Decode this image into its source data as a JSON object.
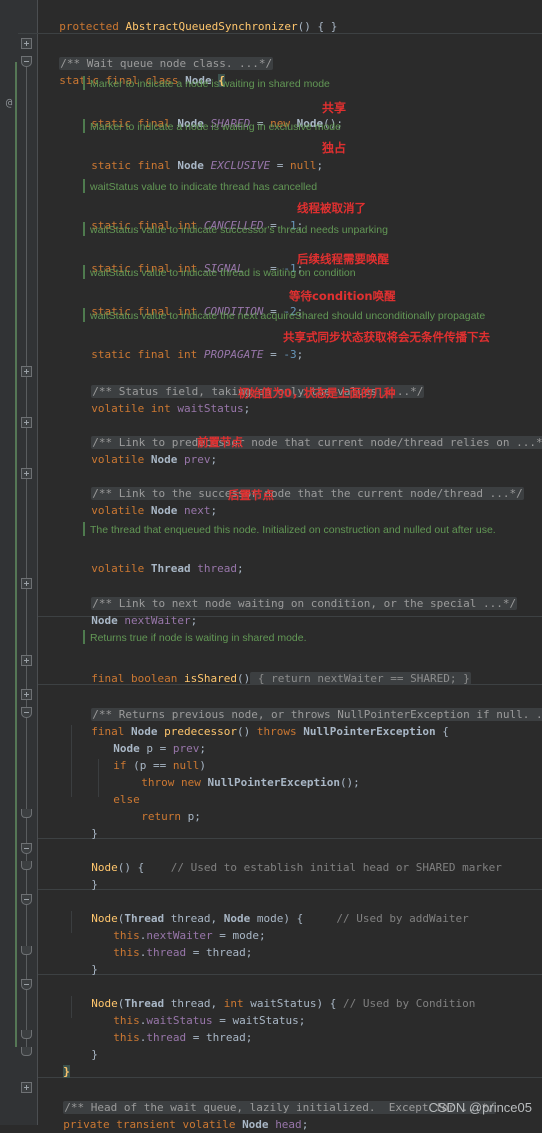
{
  "app": {
    "title": "AbstractQueuedSynchronizer.java",
    "theme": "darcula",
    "accent": "#cc7832",
    "annotation_color": "#e03030",
    "brace_highlight_color": "#3b514d"
  },
  "gutter": {
    "at_icon": "@",
    "fold_collapsed_icon": "+",
    "fold_expanded_icon": "-"
  },
  "code": {
    "l1": {
      "kw": "protected ",
      "name": "AbstractQueuedSynchronizer",
      "rest": "() { }"
    },
    "l2": {
      "folded_doc": "/** Wait queue node class. ...*/"
    },
    "l3": {
      "kw": "static final class ",
      "type": "Node",
      "brace": "{"
    },
    "l4": {
      "doc": "Marker to indicate a node is waiting in shared mode"
    },
    "l5": {
      "kw": "static final ",
      "type": "Node ",
      "sfield": "SHARED",
      "eq": " = ",
      "new": "new ",
      "call": "Node",
      "rest": "();"
    },
    "l5a": {
      "anno": "共享"
    },
    "l6": {
      "doc": "Marker to indicate a node is waiting in exclusive mode"
    },
    "l7": {
      "kw": "static final ",
      "type": "Node ",
      "sfield": "EXCLUSIVE",
      "eq": " = ",
      "kw2": "null",
      "rest": ";"
    },
    "l7a": {
      "anno": "独占"
    },
    "l8": {
      "doc": "waitStatus value to indicate thread has cancelled"
    },
    "l9": {
      "kw": "static final int ",
      "sfield": "CANCELLED",
      "eq": " =  ",
      "num": "1",
      "rest": ";"
    },
    "l9a": {
      "anno": "线程被取消了"
    },
    "l10": {
      "doc": "waitStatus value to indicate successor's thread needs unparking"
    },
    "l11": {
      "kw": "static final int ",
      "sfield": "SIGNAL",
      "eq": "    = ",
      "num": "-1",
      "rest": ";"
    },
    "l11a": {
      "anno": "后续线程需要唤醒"
    },
    "l12": {
      "doc": "waitStatus value to indicate thread is waiting on condition"
    },
    "l13": {
      "kw": "static final int ",
      "sfield": "CONDITION",
      "eq": " = ",
      "num": "-2",
      "rest": ";"
    },
    "l13a": {
      "anno": "等待condition唤醒"
    },
    "l14": {
      "doc": "waitStatus value to indicate the next acquireShared should unconditionally propagate"
    },
    "l15": {
      "kw": "static final int ",
      "sfield": "PROPAGATE",
      "eq": " = ",
      "num": "-3",
      "rest": ";"
    },
    "l15a": {
      "anno": "共享式同步状态获取将会无条件传播下去"
    },
    "l16": {
      "folded_doc": "/** Status field, taking on only the values: ...*/"
    },
    "l17": {
      "kw": "volatile int ",
      "field": "waitStatus",
      "rest": ";"
    },
    "l17a": {
      "anno": "初始值为0，状态是上面的几种"
    },
    "l18": {
      "folded_doc": "/** Link to predecessor node that current node/thread relies on ...*/"
    },
    "l19": {
      "kw": "volatile ",
      "type": "Node ",
      "field": "prev",
      "rest": ";"
    },
    "l19a": {
      "anno": "前置节点"
    },
    "l20": {
      "folded_doc": "/** Link to the successor node that the current node/thread ...*/"
    },
    "l21": {
      "kw": "volatile ",
      "type": "Node ",
      "field": "next",
      "rest": ";"
    },
    "l21a": {
      "anno": "后置节点"
    },
    "l22": {
      "doc": "The thread that enqueued this node. Initialized on construction and nulled out after use."
    },
    "l23": {
      "kw": "volatile ",
      "type": "Thread ",
      "field": "thread",
      "rest": ";"
    },
    "l24": {
      "folded_doc": "/** Link to next node waiting on condition, or the special ...*/"
    },
    "l25": {
      "type": "Node ",
      "field": "nextWaiter",
      "rest": ";"
    },
    "l26": {
      "doc": "Returns true if node is waiting in shared mode."
    },
    "l27": {
      "kw": "final boolean ",
      "method": "isShared",
      "parens": "()",
      "folded_body": " { return nextWaiter == SHARED; }"
    },
    "l28": {
      "folded_doc": "/** Returns previous node, or throws NullPointerException if null. ...*/"
    },
    "l29": {
      "kw": "final ",
      "type": "Node ",
      "method": "predecessor",
      "parens": "() ",
      "kw2": "throws ",
      "type2": "NullPointerException",
      "brace": " {"
    },
    "l30": {
      "type": "Node ",
      "ident": "p = ",
      "field": "prev",
      "rest": ";"
    },
    "l31": {
      "kw": "if ",
      "rest": "(p == ",
      "kw2": "null",
      "rest2": ")"
    },
    "l32": {
      "kw": "throw new ",
      "type": "NullPointerException",
      "rest": "();"
    },
    "l33": {
      "kw": "else"
    },
    "l34": {
      "kw": "return ",
      "rest": "p;"
    },
    "l35": {
      "rest": "}"
    },
    "l36": {
      "method": "Node",
      "parens": "() { ",
      "cmt": "   // Used to establish initial head or SHARED marker"
    },
    "l37": {
      "rest": "}"
    },
    "l38": {
      "method": "Node",
      "parens": "(",
      "type": "Thread ",
      "ident": "thread, ",
      "type2": "Node ",
      "ident2": "mode",
      "brace": ") { ",
      "cmt": "    // Used by addWaiter"
    },
    "l39": {
      "kw": "this",
      "dot": ".",
      "field": "nextWaiter",
      "rest": " = mode;"
    },
    "l40": {
      "kw": "this",
      "dot": ".",
      "field": "thread",
      "rest": " = thread;"
    },
    "l41": {
      "rest": "}"
    },
    "l42": {
      "method": "Node",
      "parens": "(",
      "type": "Thread ",
      "ident": "thread, ",
      "kw": "int ",
      "ident2": "waitStatus",
      "brace": ") { ",
      "cmt": "// Used by Condition"
    },
    "l43": {
      "kw": "this",
      "dot": ".",
      "field": "waitStatus",
      "rest": " = waitStatus;"
    },
    "l44": {
      "kw": "this",
      "dot": ".",
      "field": "thread",
      "rest": " = thread;"
    },
    "l45": {
      "rest": "}"
    },
    "l46": {
      "brace": "}"
    },
    "l47": {
      "folded_doc": "/** Head of the wait queue, lazily initialized.  Except for ...*/"
    },
    "l48": {
      "kw": "private transient volatile ",
      "type": "Node ",
      "field": "head",
      "rest": ";"
    }
  },
  "watermark": {
    "text": "CSDN @prince05"
  }
}
